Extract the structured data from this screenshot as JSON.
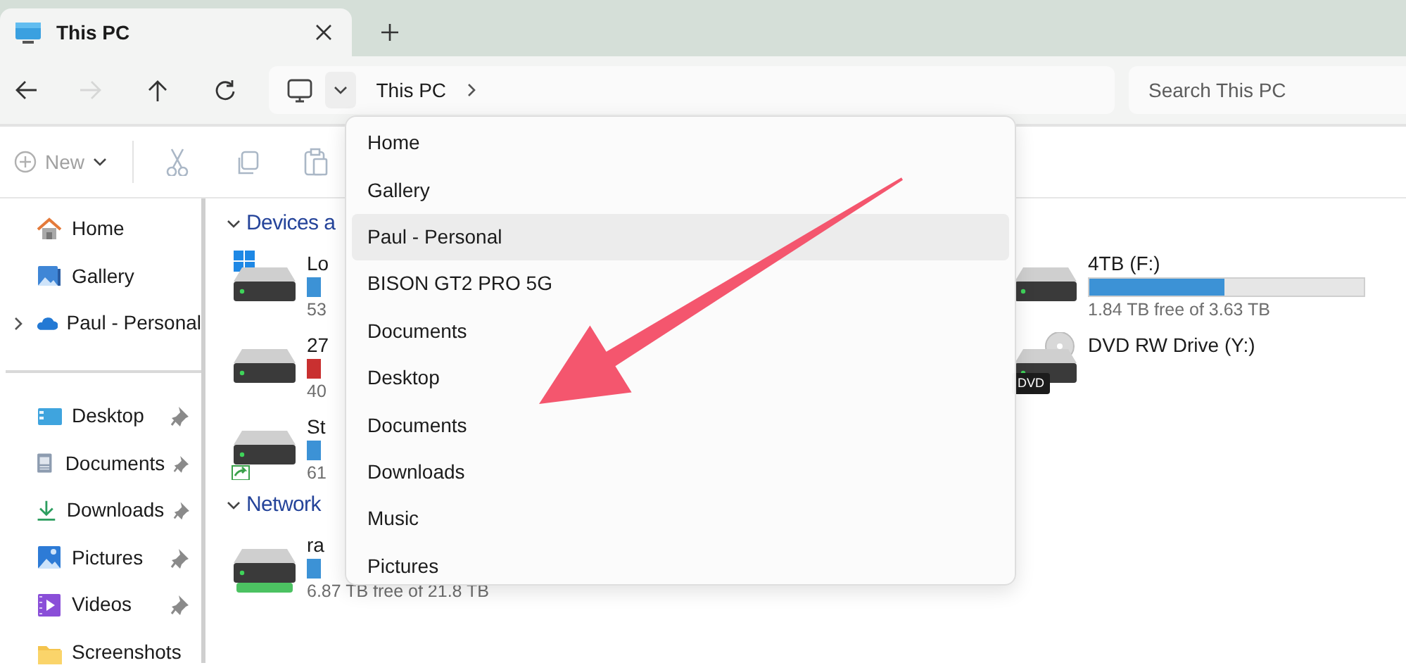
{
  "tabs": [
    {
      "title": "This PC",
      "selected": true
    }
  ],
  "nav_buttons": [
    {
      "kind": "back",
      "disabled": false
    },
    {
      "kind": "forward",
      "disabled": true
    },
    {
      "kind": "up",
      "disabled": false
    },
    {
      "kind": "refresh",
      "disabled": false
    }
  ],
  "address": {
    "crumbs": [
      "This PC"
    ]
  },
  "search": {
    "placeholder": "Search This PC"
  },
  "toolbar": [
    {
      "kind": "new",
      "label": "New",
      "disabled": true
    },
    {
      "kind": "cut",
      "disabled": true
    },
    {
      "kind": "copy",
      "disabled": true
    },
    {
      "kind": "paste",
      "disabled": true
    }
  ],
  "sidebar": {
    "groups": [
      [
        {
          "kind": "home",
          "label": "Home"
        },
        {
          "kind": "gallery",
          "label": "Gallery"
        },
        {
          "kind": "cloud",
          "label": "Paul - Personal",
          "expanded": false
        }
      ],
      [
        {
          "kind": "desktop",
          "label": "Desktop",
          "pinned": true
        },
        {
          "kind": "documents",
          "label": "Documents",
          "pinned": true
        },
        {
          "kind": "downloads",
          "label": "Downloads",
          "pinned": true
        },
        {
          "kind": "pictures",
          "label": "Pictures",
          "pinned": true
        },
        {
          "kind": "videos",
          "label": "Videos",
          "pinned": true
        },
        {
          "kind": "folder",
          "label": "Screenshots",
          "pinned": false
        }
      ]
    ]
  },
  "sections": [
    {
      "title": "Devices a",
      "expanded": true,
      "drives": [
        {
          "kind": "system",
          "name": "Lo",
          "color": "#3c92d6",
          "free": "53"
        },
        {
          "kind": "disk",
          "name": "4TB (F:)",
          "color": "#3c92d6",
          "level": 0.49,
          "free": "1.84 TB free of 3.63 TB"
        },
        {
          "kind": "disk",
          "name": "27",
          "color": "#c93030",
          "free": "40"
        },
        {
          "kind": "dvd",
          "name": "DVD RW Drive (Y:)",
          "badge": "DVD"
        },
        {
          "kind": "shortcut",
          "name": "St",
          "color": "#3c92d6",
          "free": "61"
        }
      ]
    },
    {
      "title": "Network",
      "expanded": true,
      "drives": [
        {
          "kind": "network",
          "name": "ra",
          "color": "#3c92d6",
          "free": "6.87 TB free of 21.8 TB"
        }
      ]
    }
  ],
  "dropdown": [
    {
      "label": "Home",
      "selected": false
    },
    {
      "label": "Gallery",
      "selected": false
    },
    {
      "label": "Paul - Personal",
      "selected": true
    },
    {
      "label": "BISON GT2 PRO 5G",
      "selected": false
    },
    {
      "label": "Documents",
      "selected": false
    },
    {
      "label": "Desktop",
      "selected": false
    },
    {
      "label": "Documents",
      "selected": false
    },
    {
      "label": "Downloads",
      "selected": false
    },
    {
      "label": "Music",
      "selected": false
    },
    {
      "label": "Pictures",
      "selected": false
    }
  ]
}
